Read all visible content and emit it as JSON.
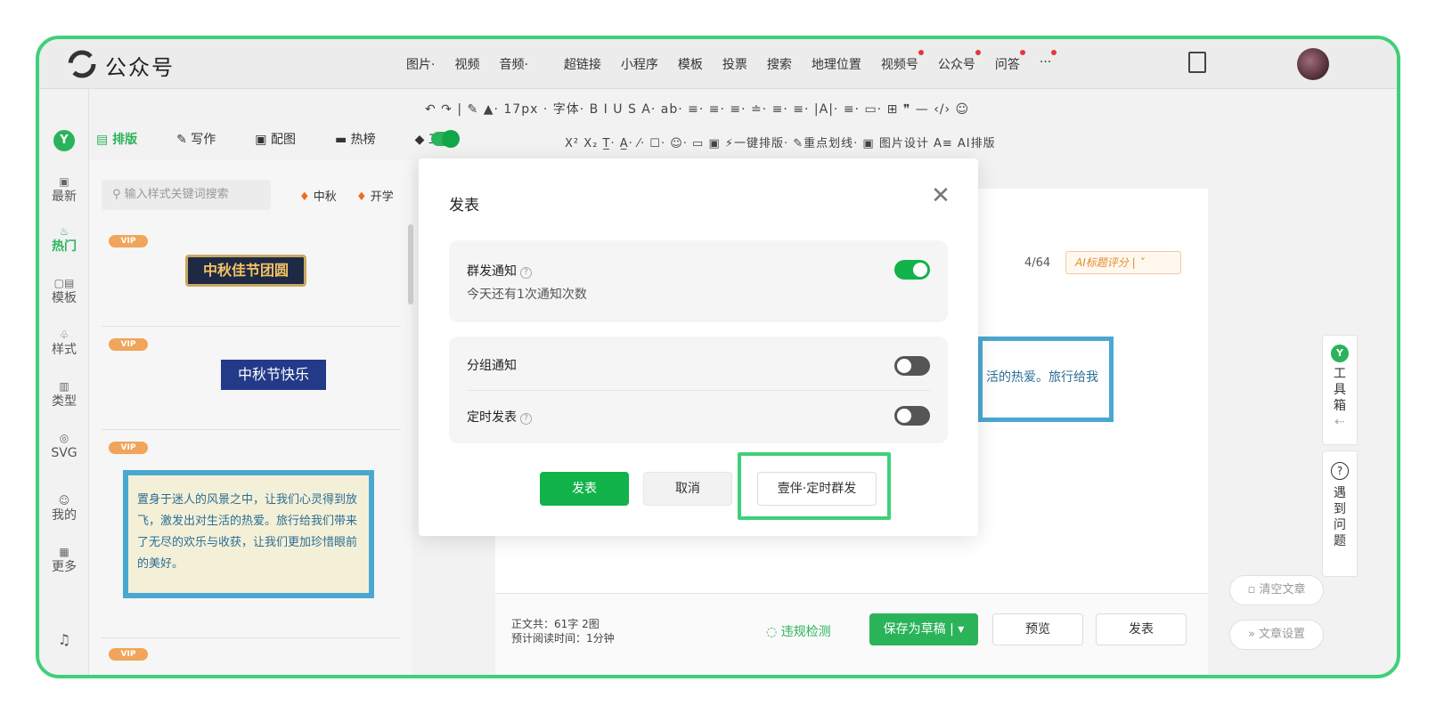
{
  "app": {
    "name": "公众号"
  },
  "top_menu": [
    {
      "label": "图片·",
      "dot": false
    },
    {
      "label": "视频",
      "dot": false
    },
    {
      "label": "音频·",
      "dot": false
    },
    {
      "label": "超链接",
      "dot": false
    },
    {
      "label": "小程序",
      "dot": false
    },
    {
      "label": "模板",
      "dot": false
    },
    {
      "label": "投票",
      "dot": false
    },
    {
      "label": "搜索",
      "dot": false
    },
    {
      "label": "地理位置",
      "dot": false
    },
    {
      "label": "视频号",
      "dot": true
    },
    {
      "label": "公众号",
      "dot": true
    },
    {
      "label": "问答",
      "dot": true
    },
    {
      "label": "···",
      "dot": true
    }
  ],
  "editor_toolbar": {
    "row1": "↶ ↷ | ✎ ▲· 17px · 字体· B I U S A· ab· ≡· ≡· ≡· ≐· ≡· ≡· |A|· ≡· ▭· ⊞ ❞ — ‹/› ☺",
    "row2": "X² X₂ T̲· A̲· ⁄· ☐· ☺· ▭ ▣ ⚡一键排版· ✎重点划线· ▣ 图片设计 A≡ AI排版"
  },
  "plugin_tabs": [
    {
      "label": "排版",
      "icon": "layout-icon",
      "active": true
    },
    {
      "label": "写作",
      "icon": "pen-icon",
      "active": false
    },
    {
      "label": "配图",
      "icon": "image-icon",
      "active": false
    },
    {
      "label": "热榜",
      "icon": "flag-icon",
      "active": false
    },
    {
      "label": "工具",
      "icon": "tool-icon",
      "active": false
    }
  ],
  "sidenav": [
    {
      "label": "最新",
      "icon": "▣",
      "active": false
    },
    {
      "label": "热门",
      "icon": "♨",
      "active": true
    },
    {
      "label": "模板",
      "icon": "▢▤",
      "active": false
    },
    {
      "label": "样式",
      "icon": "♧",
      "active": false
    },
    {
      "label": "类型",
      "icon": "▥",
      "active": false
    },
    {
      "label": "SVG",
      "icon": "◎",
      "active": false
    },
    {
      "label": "我的",
      "icon": "☺",
      "active": false
    },
    {
      "label": "更多",
      "icon": "▦",
      "active": false
    }
  ],
  "style_panel": {
    "search_placeholder": "输入样式关键词搜索",
    "hot_tags": [
      "中秋",
      "开学"
    ],
    "vip_label": "VIP",
    "item1_title": "中秋佳节团圆",
    "item2_title": "中秋节快乐",
    "item3_text": "置身于迷人的风景之中，让我们心灵得到放飞，激发出对生活的热爱。旅行给我们带来了无尽的欢乐与收获，让我们更加珍惜眼前的美好。"
  },
  "editor": {
    "title_count": "4/64",
    "ai_score": "AI标题评分 | ˅",
    "card_text": "活的热爱。旅行给我"
  },
  "bottom_bar": {
    "word_count": "正文共：61字 2图",
    "read_time": "预计阅读时间：1分钟",
    "check": "违规检测",
    "save": "保存为草稿 | ▾",
    "preview": "预览",
    "publish": "发表"
  },
  "right_side": {
    "toolbox_label": "工具箱",
    "help_label": "遇到问题",
    "clear_article": "清空文章",
    "article_settings": "文章设置"
  },
  "modal": {
    "title": "发表",
    "mass_notify_label": "群发通知",
    "mass_notify_sub": "今天还有1次通知次数",
    "mass_notify_on": true,
    "group_notify_label": "分组通知",
    "group_notify_on": false,
    "timed_label": "定时发表",
    "timed_on": false,
    "btn_publish": "发表",
    "btn_cancel": "取消",
    "btn_timed": "壹伴·定时群发"
  },
  "colors": {
    "accent": "#12b34a",
    "highlight": "#3fd07a"
  }
}
